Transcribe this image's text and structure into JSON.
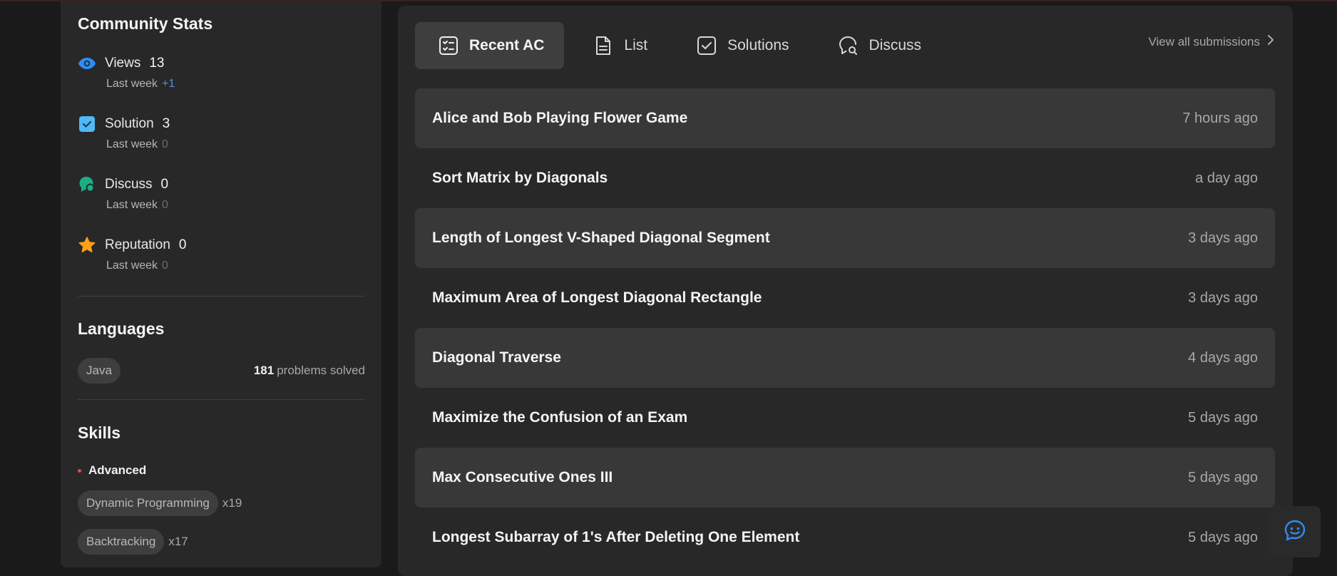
{
  "community_stats": {
    "title": "Community Stats",
    "items": [
      {
        "label": "Views",
        "value": "13",
        "sub_label": "Last week",
        "sub_value": "+1",
        "icon": "eye-icon",
        "color": "#2f8df2"
      },
      {
        "label": "Solution",
        "value": "3",
        "sub_label": "Last week",
        "sub_value": "0",
        "icon": "solution-check-icon",
        "color": "#4fb8f5"
      },
      {
        "label": "Discuss",
        "value": "0",
        "sub_label": "Last week",
        "sub_value": "0",
        "icon": "discuss-icon",
        "color": "#1aae87"
      },
      {
        "label": "Reputation",
        "value": "0",
        "sub_label": "Last week",
        "sub_value": "0",
        "icon": "star-icon",
        "color": "#ffa116"
      }
    ]
  },
  "languages": {
    "title": "Languages",
    "chip": "Java",
    "count": "181",
    "count_label": "problems solved"
  },
  "skills": {
    "title": "Skills",
    "level": "Advanced",
    "items": [
      {
        "name": "Dynamic Programming",
        "count": "x19"
      },
      {
        "name": "Backtracking",
        "count": "x17"
      }
    ]
  },
  "tabs": [
    {
      "label": "Recent AC",
      "icon": "checklist-icon",
      "active": true
    },
    {
      "label": "List",
      "icon": "document-icon",
      "active": false
    },
    {
      "label": "Solutions",
      "icon": "check-square-icon",
      "active": false
    },
    {
      "label": "Discuss",
      "icon": "discuss-search-icon",
      "active": false
    }
  ],
  "view_all": "View all submissions",
  "submissions": [
    {
      "title": "Alice and Bob Playing Flower Game",
      "time": "7 hours ago"
    },
    {
      "title": "Sort Matrix by Diagonals",
      "time": "a day ago"
    },
    {
      "title": "Length of Longest V-Shaped Diagonal Segment",
      "time": "3 days ago"
    },
    {
      "title": "Maximum Area of Longest Diagonal Rectangle",
      "time": "3 days ago"
    },
    {
      "title": "Diagonal Traverse",
      "time": "4 days ago"
    },
    {
      "title": "Maximize the Confusion of an Exam",
      "time": "5 days ago"
    },
    {
      "title": "Max Consecutive Ones III",
      "time": "5 days ago"
    },
    {
      "title": "Longest Subarray of 1's After Deleting One Element",
      "time": "5 days ago"
    }
  ],
  "chat_icon": "chat-bot-icon"
}
